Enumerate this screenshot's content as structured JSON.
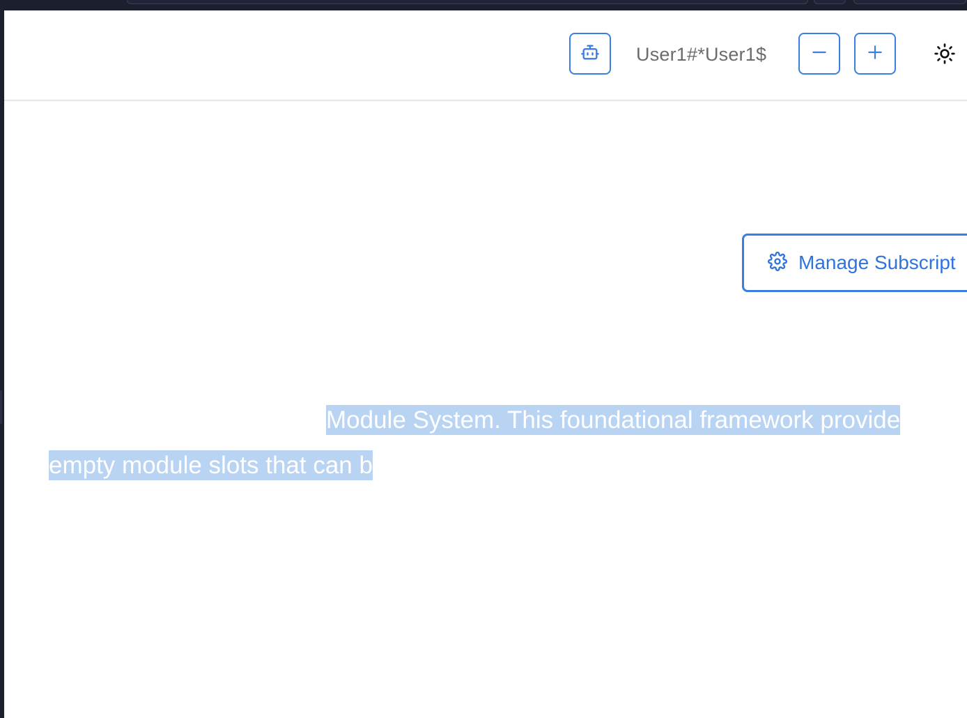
{
  "header": {
    "username": "User1#*User1$",
    "bot_icon": "bot-icon",
    "minus_icon": "minus-icon",
    "plus_icon": "plus-icon",
    "theme_icon": "sun-icon"
  },
  "main": {
    "manage_button_label": "Manage Subscript",
    "manage_button_icon": "gear-icon",
    "description_line1": " Module System. This foundational framework provide",
    "description_line2": "empty module slots that can b"
  },
  "colors": {
    "accent": "#3b7de0",
    "selection": "#b9d3f3",
    "chrome": "#1b1f2e"
  }
}
